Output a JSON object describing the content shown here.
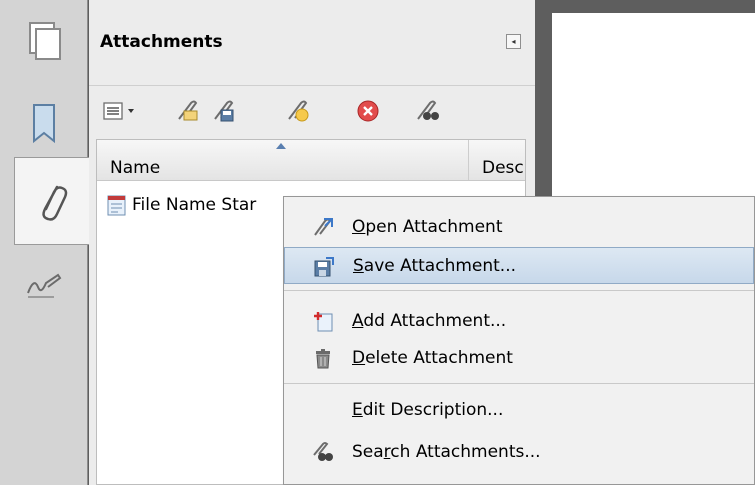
{
  "panel": {
    "title": "Attachments",
    "collapse_glyph": "◂"
  },
  "columns": {
    "name": "Name",
    "description": "Desc"
  },
  "files": [
    {
      "name": "File Name Star"
    }
  ],
  "context_menu": {
    "items": [
      {
        "label_ul": "O",
        "label_rest": "pen Attachment",
        "icon": "open-attachment-icon"
      },
      {
        "label_ul": "S",
        "label_rest": "ave Attachment...",
        "icon": "save-attachment-icon",
        "highlighted": true
      },
      {
        "label_ul": "A",
        "label_rest": "dd Attachment...",
        "icon": "add-attachment-icon"
      },
      {
        "label_ul": "D",
        "label_rest": "elete Attachment",
        "icon": "delete-attachment-icon"
      },
      {
        "label_ul": "E",
        "label_rest": "dit Description...",
        "icon": ""
      },
      {
        "label_pre": "Sea",
        "label_ul": "r",
        "label_rest": "ch Attachments...",
        "icon": "search-attachments-icon"
      }
    ]
  },
  "colors": {
    "highlight_top": "#dde8f3",
    "highlight_bottom": "#c7d8ea",
    "rail": "#d4d4d4",
    "doc_bg": "#5e5e5e"
  }
}
